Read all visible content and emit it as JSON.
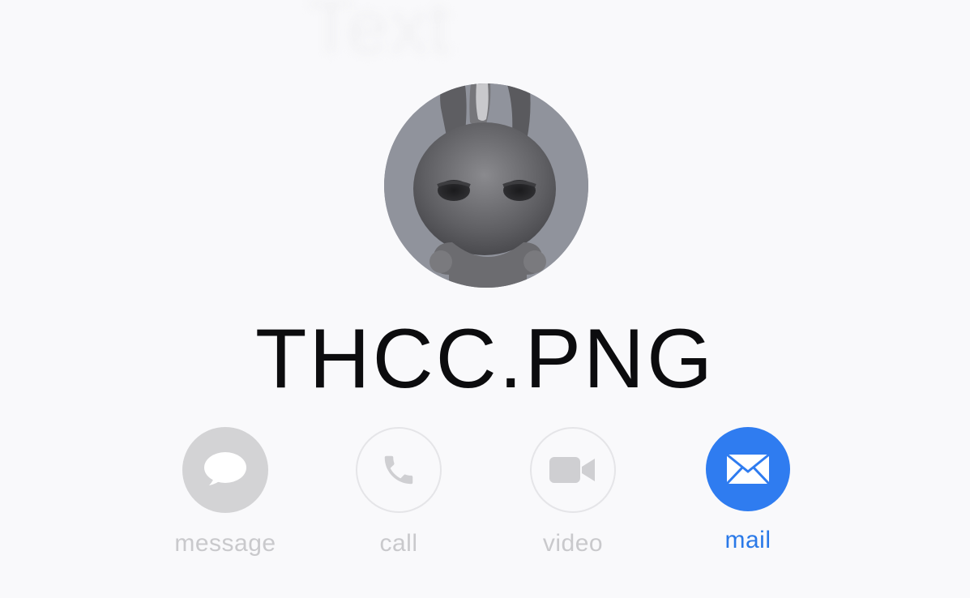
{
  "header": {
    "ghost_title": "Text"
  },
  "contact": {
    "name": "THCC.PNG",
    "avatar_icon": "bunny-avatar-icon"
  },
  "actions": [
    {
      "label": "message",
      "icon": "message-bubble-icon",
      "state": "disabled"
    },
    {
      "label": "call",
      "icon": "phone-icon",
      "state": "disabled"
    },
    {
      "label": "video",
      "icon": "video-camera-icon",
      "state": "disabled"
    },
    {
      "label": "mail",
      "icon": "envelope-icon",
      "state": "enabled"
    }
  ],
  "colors": {
    "accent": "#2f7cf0",
    "disabled": "#c9c9cc",
    "background": "#f9f9fb",
    "name_text": "#0c0c0e"
  }
}
